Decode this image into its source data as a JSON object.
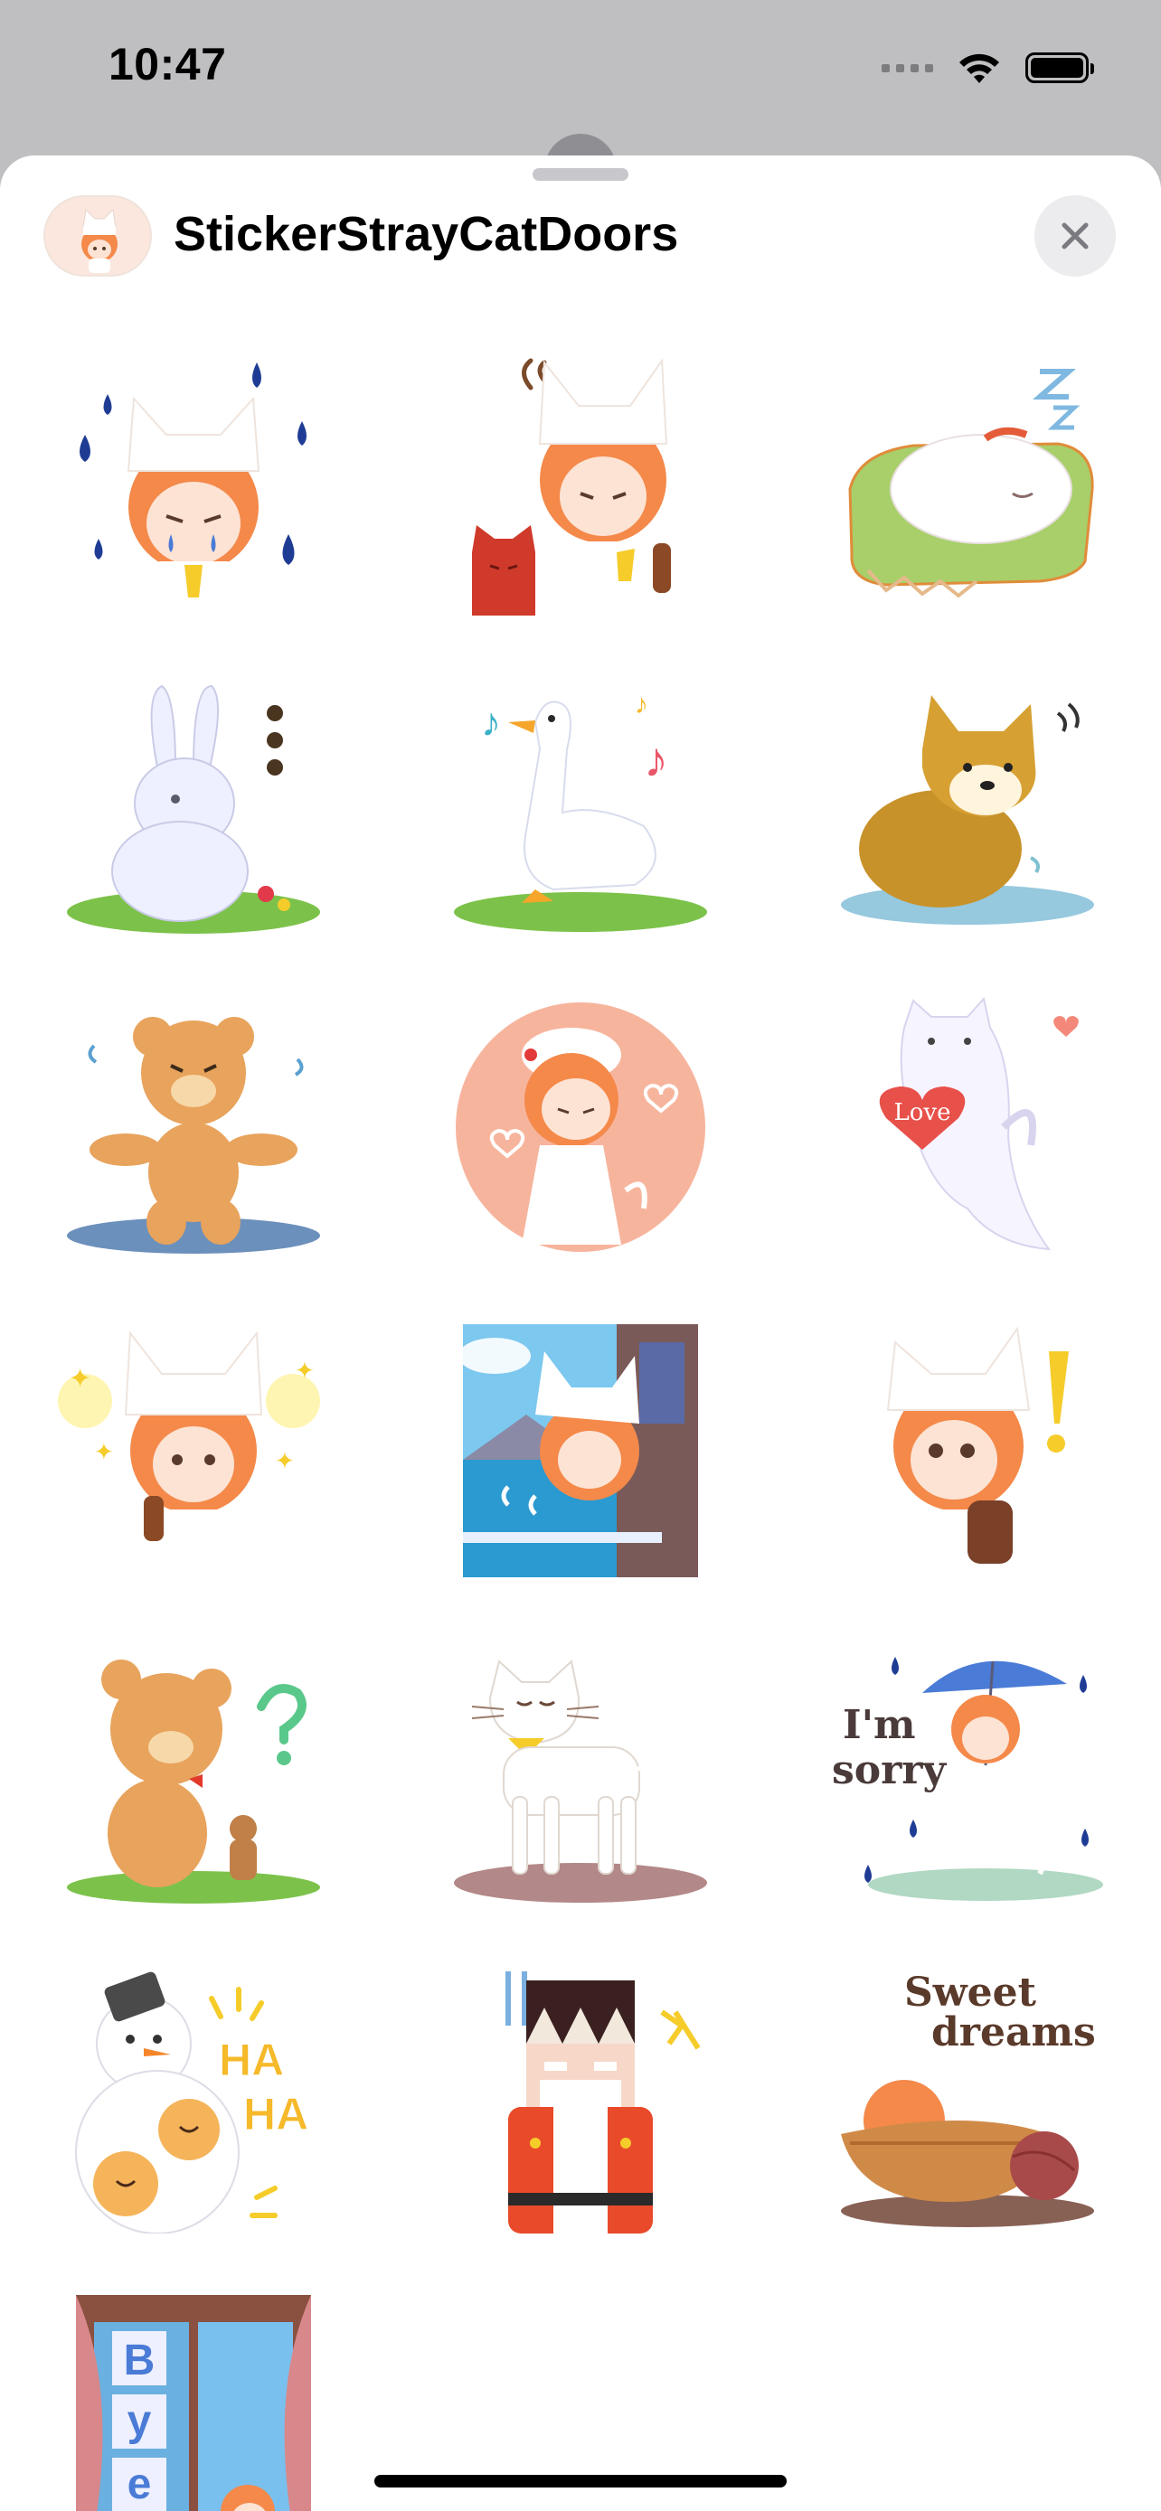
{
  "status_bar": {
    "time": "10:47"
  },
  "sheet": {
    "title": "StickerStrayCatDoors",
    "close_icon": "close-icon"
  },
  "stickers": [
    {
      "name": "crying-girl-sticker",
      "icon": "crying-cat-hat-girl"
    },
    {
      "name": "girl-with-red-cat-sticker",
      "icon": "girl-red-cat"
    },
    {
      "name": "sleeping-cat-sticker",
      "icon": "sleeping-cat-cushion"
    },
    {
      "name": "rabbit-sticker",
      "icon": "white-rabbit"
    },
    {
      "name": "goose-sticker",
      "icon": "singing-goose"
    },
    {
      "name": "shiba-dog-sticker",
      "icon": "shiba-dog"
    },
    {
      "name": "teddy-bear-dance-sticker",
      "icon": "teddy-bear-dance"
    },
    {
      "name": "girl-heart-circle-sticker",
      "icon": "girl-pink-circle"
    },
    {
      "name": "ghost-cat-love-sticker",
      "icon": "ghost-cat-heart"
    },
    {
      "name": "sparkle-girl-sticker",
      "icon": "girl-sparkles"
    },
    {
      "name": "window-sea-sticker",
      "icon": "girl-window-sea"
    },
    {
      "name": "surprised-girl-sticker",
      "icon": "girl-exclamation"
    },
    {
      "name": "bear-cookie-sticker",
      "icon": "bear-gingerbread"
    },
    {
      "name": "white-cat-sticker",
      "icon": "white-cat-bell"
    },
    {
      "name": "im-sorry-sticker",
      "icon": "girl-umbrella"
    },
    {
      "name": "snowman-haha-sticker",
      "icon": "snowman-cookies"
    },
    {
      "name": "nutcracker-sticker",
      "icon": "nutcracker"
    },
    {
      "name": "sweet-dreams-sticker",
      "icon": "girl-basket-sleep"
    },
    {
      "name": "bye-window-sticker",
      "icon": "window-bye"
    }
  ],
  "sticker_text": {
    "love": "Love",
    "im_sorry_1": "I'm",
    "im_sorry_2": "sorry",
    "haha_1": "HA",
    "haha_2": "HA",
    "sweet_1": "Sweet",
    "sweet_2": "dreams",
    "bye_1": "B",
    "bye_2": "y",
    "bye_3": "e"
  },
  "colors": {
    "girl_hair": "#f4894a",
    "raindrop": "#1f3c95",
    "bear": "#e8a35c",
    "grass": "#7cc24a"
  }
}
